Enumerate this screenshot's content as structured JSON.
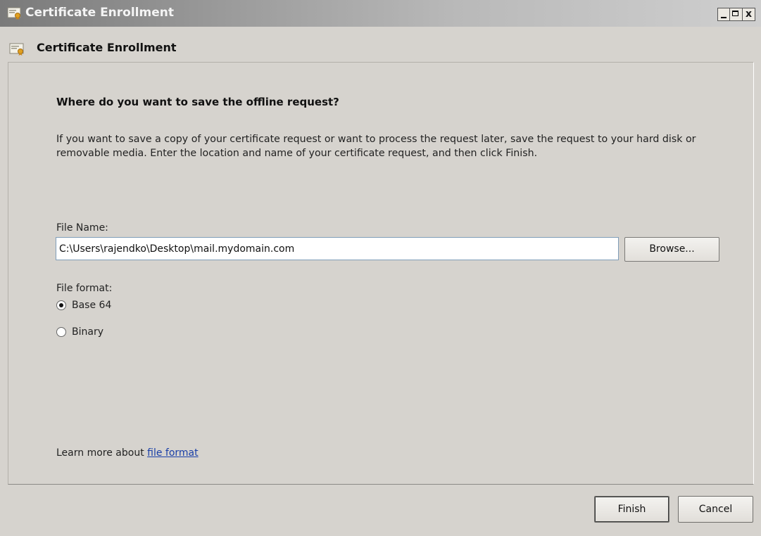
{
  "window": {
    "title": "Certificate Enrollment",
    "controls": {
      "minimize": "_",
      "maximize": "□",
      "close": "x"
    }
  },
  "header": {
    "title": "Certificate Enrollment"
  },
  "content": {
    "question": "Where do you want to save the offline request?",
    "description": "If you want to save a copy of your certificate request or want to process the request later, save the request to your hard disk or removable media. Enter the location and name of your certificate request, and then click Finish.",
    "file_name_label": "File Name:",
    "file_name_value": "C:\\Users\\rajendko\\Desktop\\mail.mydomain.com",
    "browse_label": "Browse...",
    "file_format_label": "File format:",
    "format_options": [
      {
        "label": "Base 64",
        "selected": true
      },
      {
        "label": "Binary",
        "selected": false
      }
    ],
    "learn_more_prefix": "Learn more about ",
    "learn_more_link": "file format"
  },
  "footer": {
    "finish_label": "Finish",
    "cancel_label": "Cancel"
  },
  "icons": {
    "app": "certificate-icon",
    "header": "certificate-icon"
  },
  "colors": {
    "link": "#1a3fa8",
    "background": "#d6d3ce"
  }
}
